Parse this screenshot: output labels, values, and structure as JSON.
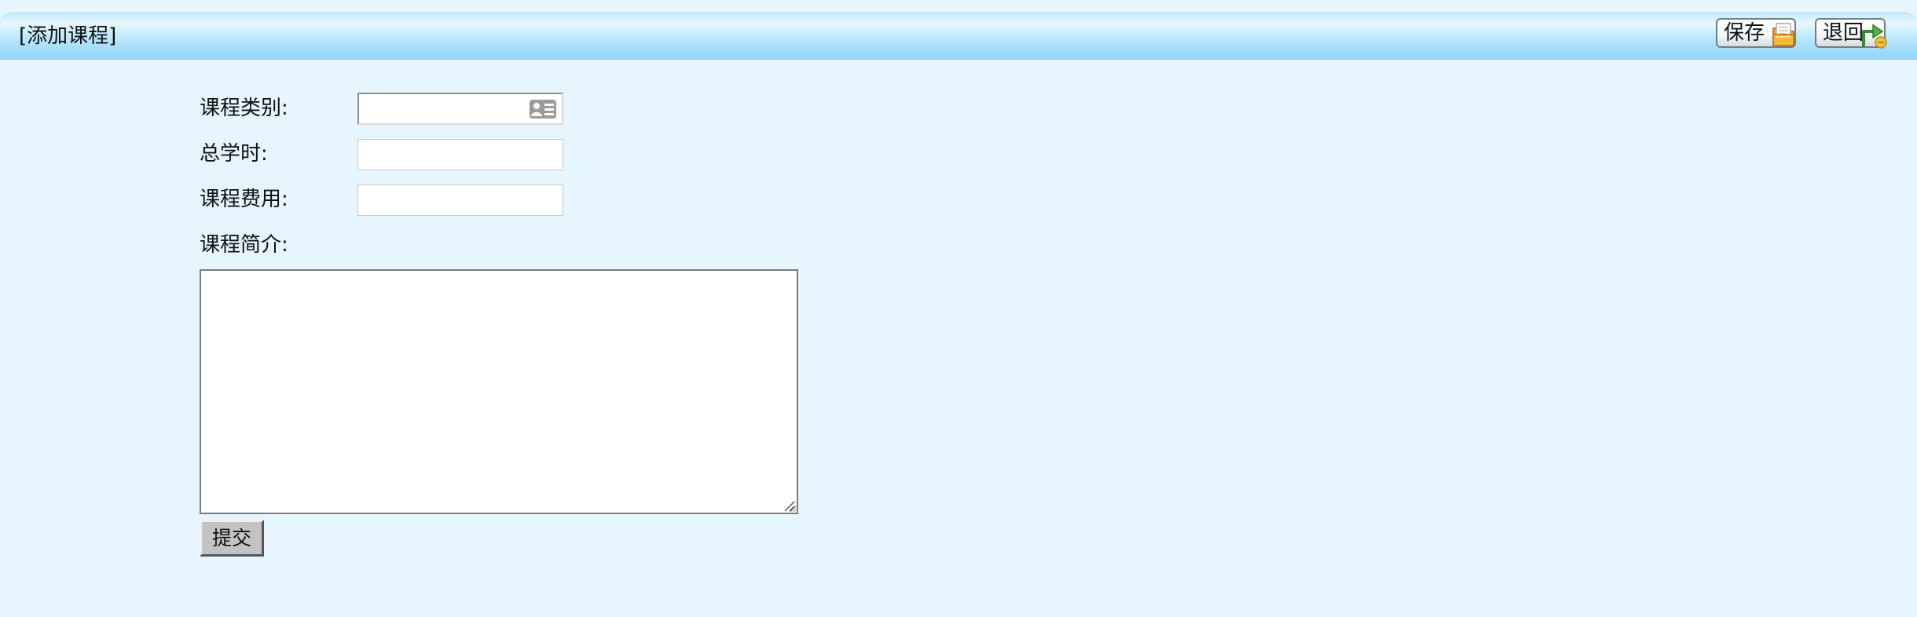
{
  "header": {
    "title": "[添加课程]",
    "save_label": "保存",
    "back_label": "退回",
    "save_icon": "folder-save-icon",
    "back_icon": "return-arrow-icon"
  },
  "form": {
    "category": {
      "label": "课程类别:",
      "value": "",
      "icon": "id-card-icon"
    },
    "total_hours": {
      "label": "总学时:",
      "value": ""
    },
    "fee": {
      "label": "课程费用:",
      "value": ""
    },
    "intro": {
      "label": "课程简介:",
      "value": ""
    },
    "submit_label": "提交"
  },
  "colors": {
    "page_background": "#e6f5fe",
    "header_gradient_top": "#c6ecfd",
    "header_gradient_bottom": "#92d4f8",
    "submit_button": "#c3c3c3"
  }
}
